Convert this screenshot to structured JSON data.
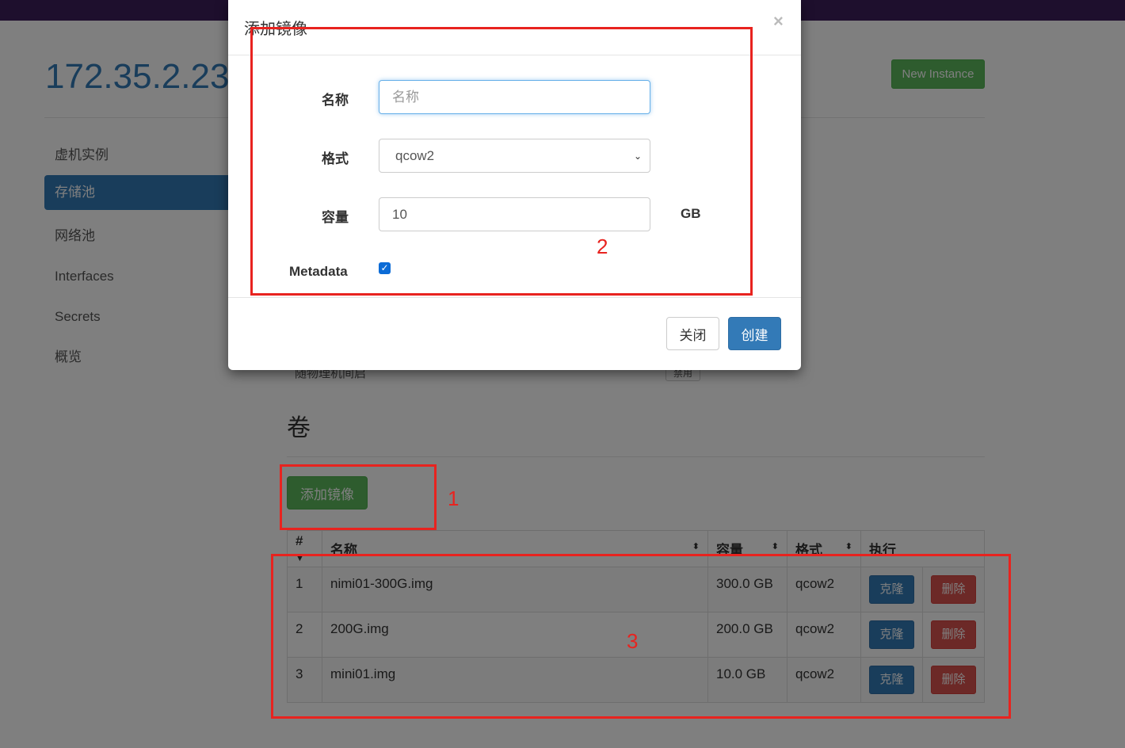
{
  "page": {
    "title": "172.35.2.23",
    "new_instance_label": "New Instance"
  },
  "sidebar": {
    "items": [
      {
        "label": "虚机实例"
      },
      {
        "label": "存储池"
      },
      {
        "label": "网络池"
      },
      {
        "label": "Interfaces"
      },
      {
        "label": "Secrets"
      },
      {
        "label": "概览"
      }
    ]
  },
  "background_row": {
    "label": "随物理机间启",
    "badge": "禁用"
  },
  "volumes": {
    "heading": "卷",
    "add_button": "添加镜像",
    "columns": [
      "#",
      "名称",
      "容量",
      "格式",
      "执行"
    ],
    "rows": [
      {
        "num": "1",
        "name": "nimi01-300G.img",
        "size": "300.0 GB",
        "format": "qcow2"
      },
      {
        "num": "2",
        "name": "200G.img",
        "size": "200.0 GB",
        "format": "qcow2"
      },
      {
        "num": "3",
        "name": "mini01.img",
        "size": "10.0 GB",
        "format": "qcow2"
      }
    ],
    "clone_label": "克隆",
    "delete_label": "删除"
  },
  "modal": {
    "title": "添加镜像",
    "close_symbol": "×",
    "name_label": "名称",
    "name_placeholder": "名称",
    "format_label": "格式",
    "format_value": "qcow2",
    "capacity_label": "容量",
    "capacity_value": "10",
    "capacity_unit": "GB",
    "metadata_label": "Metadata",
    "metadata_checked": true,
    "close_button": "关闭",
    "create_button": "创建"
  },
  "annotations": {
    "marker_1": "1",
    "marker_2": "2",
    "marker_3": "3",
    "color": "#e8231f"
  }
}
